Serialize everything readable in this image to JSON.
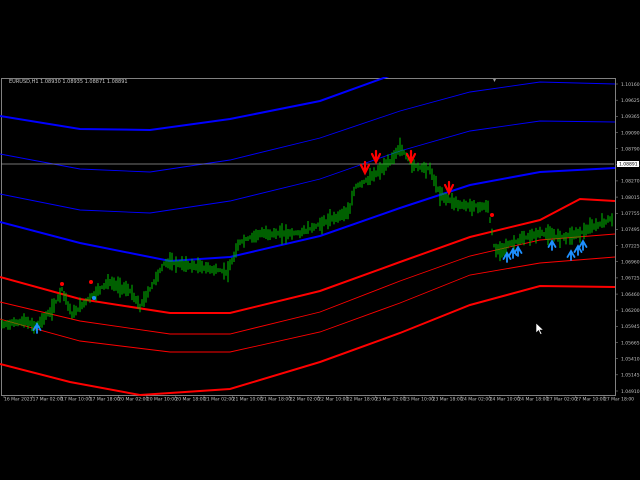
{
  "symbol_header": "EURUSD,H1  1.08930 1.08935 1.08871 1.08891",
  "current_price": "1.08891",
  "colors": {
    "background": "#000000",
    "candles": "#00c000",
    "upper_band": "#0000ff",
    "lower_band": "#ff0000",
    "buy_arrow": "#1e90ff",
    "sell_arrow": "#ff0000",
    "axis_text": "#c0c0c0",
    "price_line": "#9a9a9a"
  },
  "icons": {
    "buy": "up-arrow-icon",
    "sell": "down-arrow-icon",
    "cursor": "mouse-pointer-icon",
    "scroll": "shift-marker-icon"
  },
  "price_axis": [
    "1.10160",
    "1.09625",
    "1.09365",
    "1.09090",
    "1.08790",
    "1.08535",
    "1.08270",
    "1.08015",
    "1.07755",
    "1.07495",
    "1.07225",
    "1.06960",
    "1.06725",
    "1.06460",
    "1.06200",
    "1.05945",
    "1.05665",
    "1.05410",
    "1.05145",
    "1.04910"
  ],
  "time_axis": [
    "16 Mar 2023",
    "17 Mar 02:00",
    "17 Mar 10:00",
    "17 Mar 18:00",
    "20 Mar 02:00",
    "20 Mar 10:00",
    "20 Mar 18:00",
    "21 Mar 02:00",
    "21 Mar 10:00",
    "21 Mar 18:00",
    "22 Mar 02:00",
    "22 Mar 10:00",
    "22 Mar 18:00",
    "23 Mar 02:00",
    "23 Mar 10:00",
    "23 Mar 18:00",
    "24 Mar 02:00",
    "24 Mar 10:00",
    "24 Mar 18:00",
    "27 Mar 02:00",
    "27 Mar 10:00",
    "27 Mar 18:00"
  ],
  "signals": {
    "sell": [
      365,
      376,
      411,
      449
    ],
    "buy": [
      37,
      507,
      513,
      518,
      552,
      571,
      578,
      583
    ],
    "sell_dots": [
      62,
      91,
      492
    ],
    "buy_dots": [
      94
    ]
  }
}
